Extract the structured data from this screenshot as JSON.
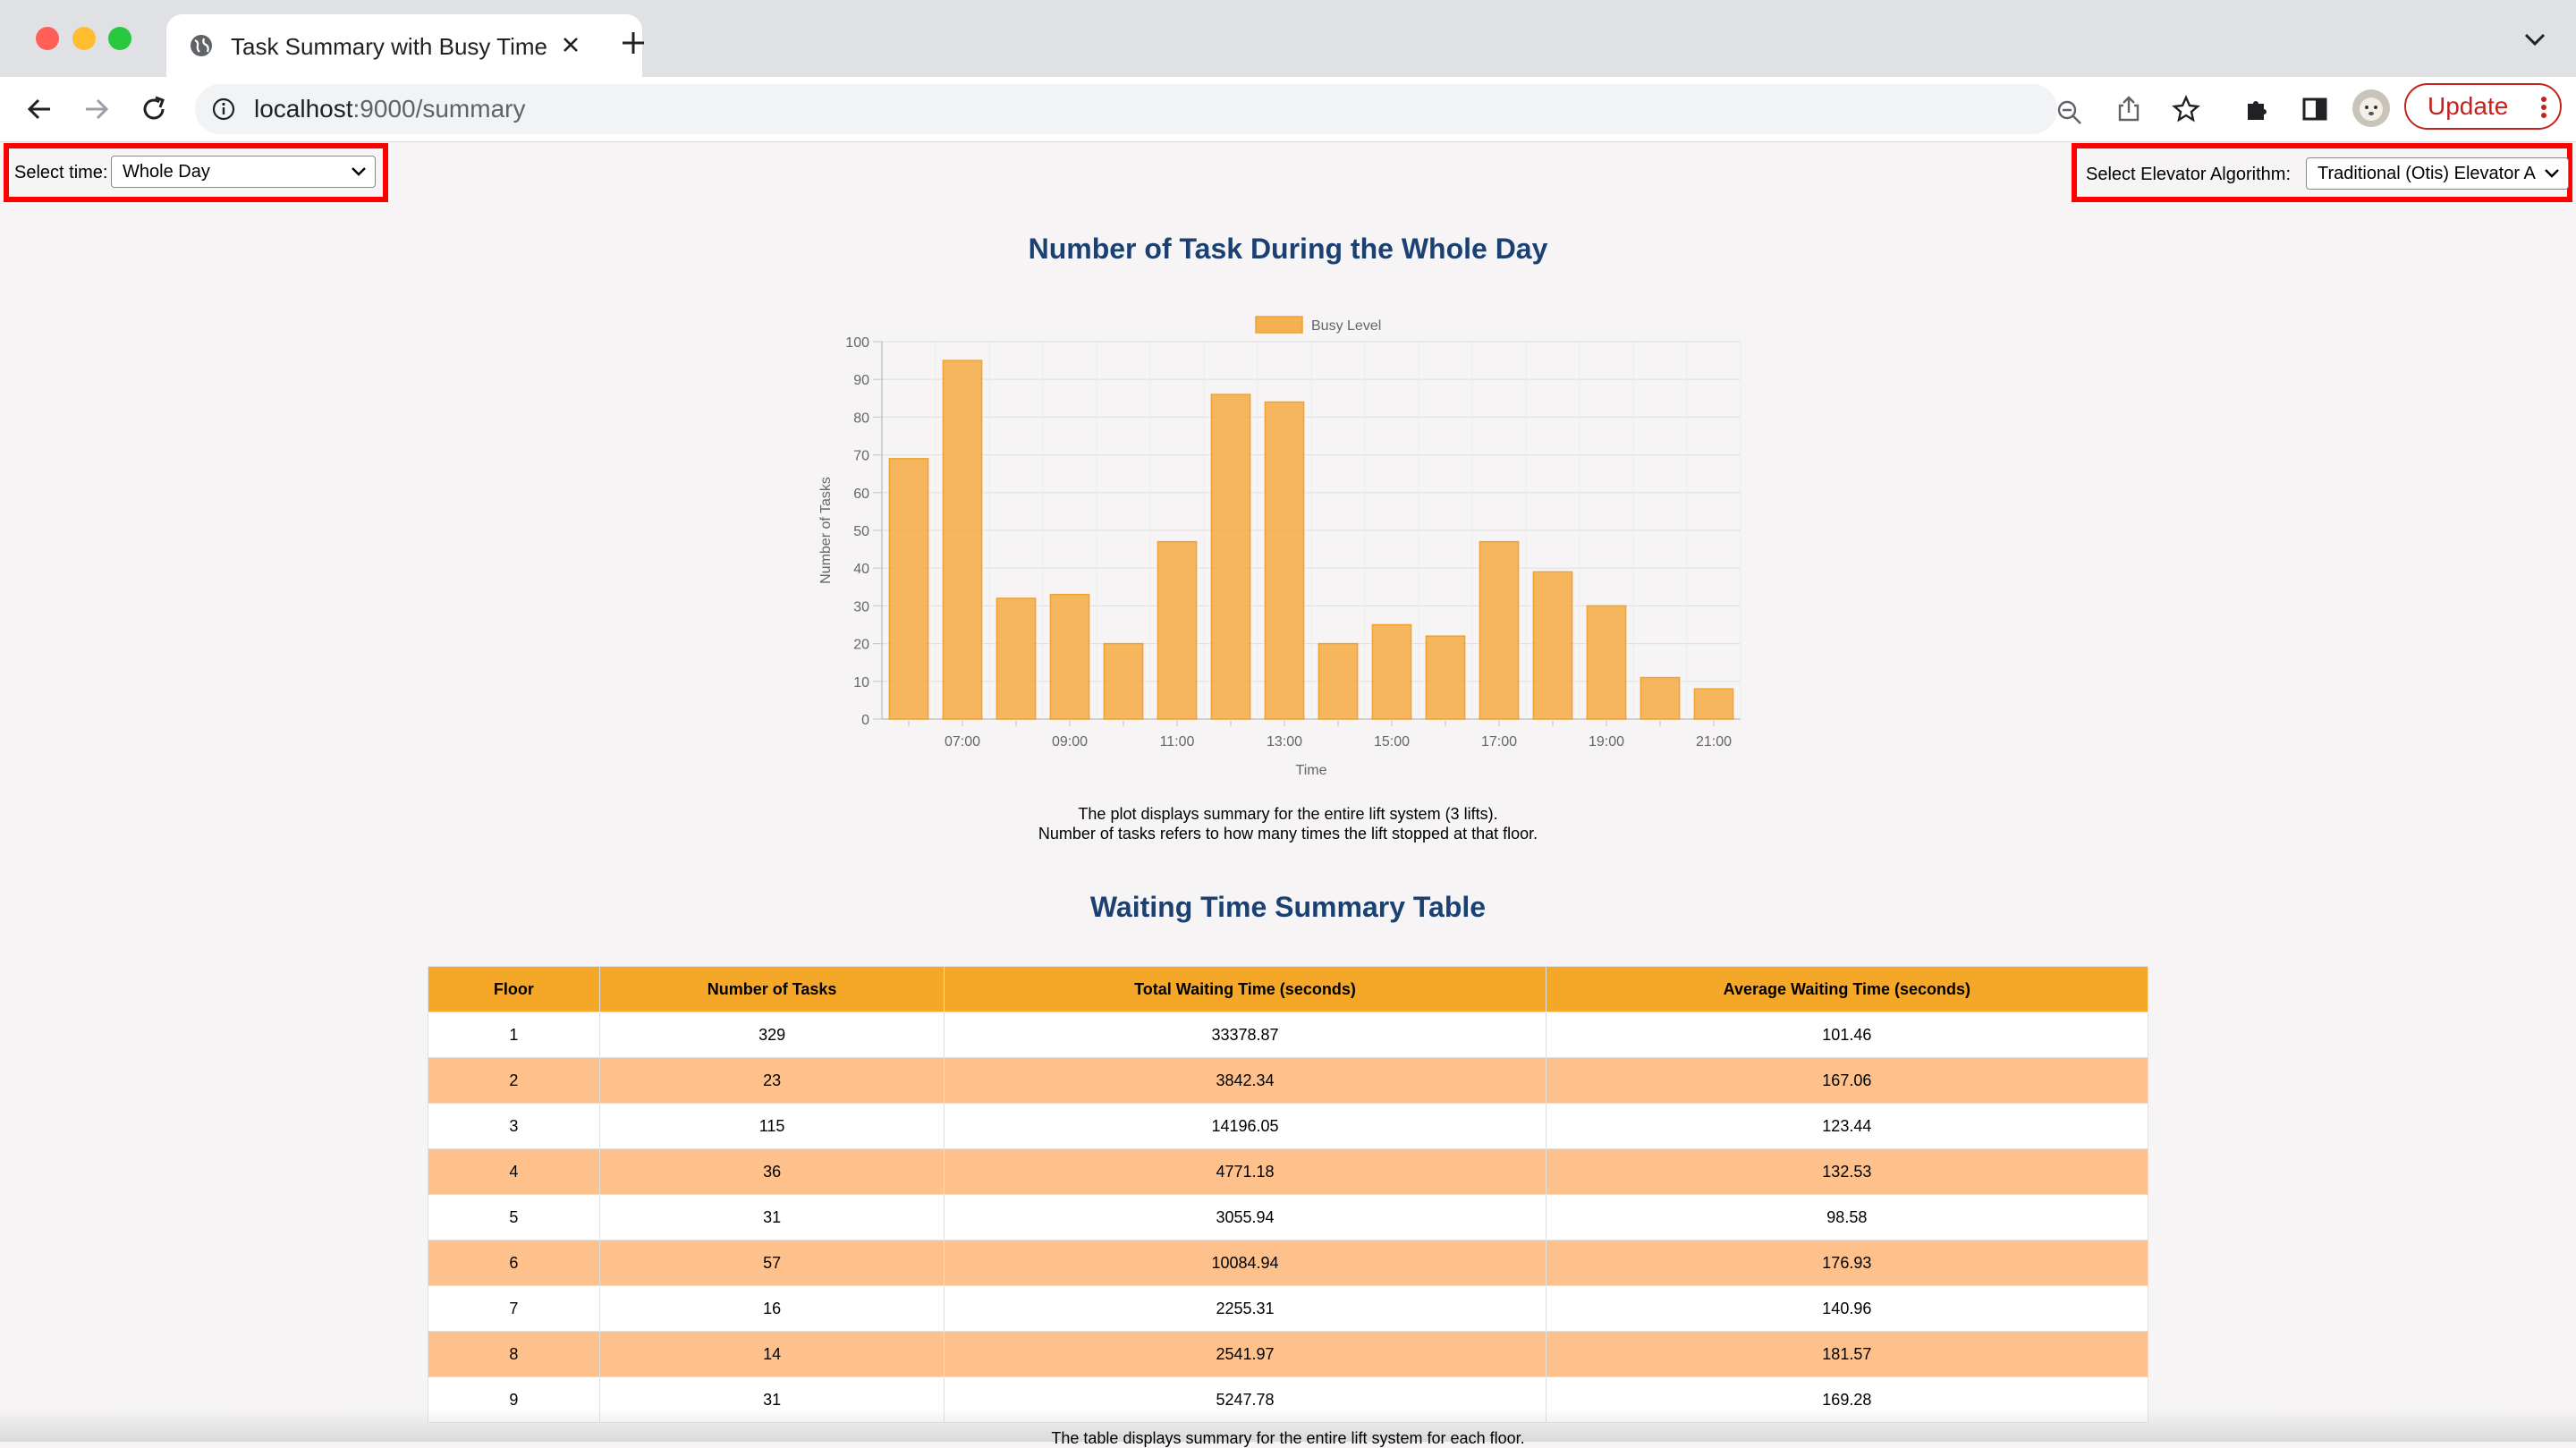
{
  "browser": {
    "tab_title": "Task Summary with Busy Time",
    "url_host": "localhost",
    "url_rest": ":9000/summary",
    "update_label": "Update"
  },
  "controls": {
    "time_label": "Select time:",
    "time_value": "Whole Day",
    "algo_label": "Select Elevator Algorithm:",
    "algo_value": "Traditional (Otis) Elevator A"
  },
  "chart_title": "Number of Task During the Whole Day",
  "chart_data": {
    "type": "bar",
    "legend": [
      "Busy Level"
    ],
    "legend_position": "top",
    "color": "#f5b04f",
    "xlabel": "Time",
    "ylabel": "Number of Tasks",
    "ylim": [
      0,
      100
    ],
    "yticks": [
      0,
      10,
      20,
      30,
      40,
      50,
      60,
      70,
      80,
      90,
      100
    ],
    "categories": [
      "06:00",
      "07:00",
      "08:00",
      "09:00",
      "10:00",
      "11:00",
      "12:00",
      "13:00",
      "14:00",
      "15:00",
      "16:00",
      "17:00",
      "18:00",
      "19:00",
      "20:00",
      "21:00"
    ],
    "visible_tick_labels": [
      "07:00",
      "09:00",
      "11:00",
      "13:00",
      "15:00",
      "17:00",
      "19:00",
      "21:00"
    ],
    "series": [
      {
        "name": "Busy Level",
        "values": [
          69,
          95,
          32,
          33,
          20,
          47,
          86,
          84,
          20,
          25,
          22,
          47,
          39,
          30,
          11,
          8
        ]
      }
    ],
    "grid": true
  },
  "chart_caption": [
    "The plot displays summary for the entire lift system (3 lifts).",
    "Number of tasks refers to how many times the lift stopped at that floor."
  ],
  "table_title": "Waiting Time Summary Table",
  "table": {
    "headers": [
      "Floor",
      "Number of Tasks",
      "Total Waiting Time (seconds)",
      "Average Waiting Time (seconds)"
    ],
    "rows": [
      [
        "1",
        "329",
        "33378.87",
        "101.46"
      ],
      [
        "2",
        "23",
        "3842.34",
        "167.06"
      ],
      [
        "3",
        "115",
        "14196.05",
        "123.44"
      ],
      [
        "4",
        "36",
        "4771.18",
        "132.53"
      ],
      [
        "5",
        "31",
        "3055.94",
        "98.58"
      ],
      [
        "6",
        "57",
        "10084.94",
        "176.93"
      ],
      [
        "7",
        "16",
        "2255.31",
        "140.96"
      ],
      [
        "8",
        "14",
        "2541.97",
        "181.57"
      ],
      [
        "9",
        "31",
        "5247.78",
        "169.28"
      ]
    ]
  },
  "table_footnote": "The table displays summary for the entire lift system for each floor."
}
